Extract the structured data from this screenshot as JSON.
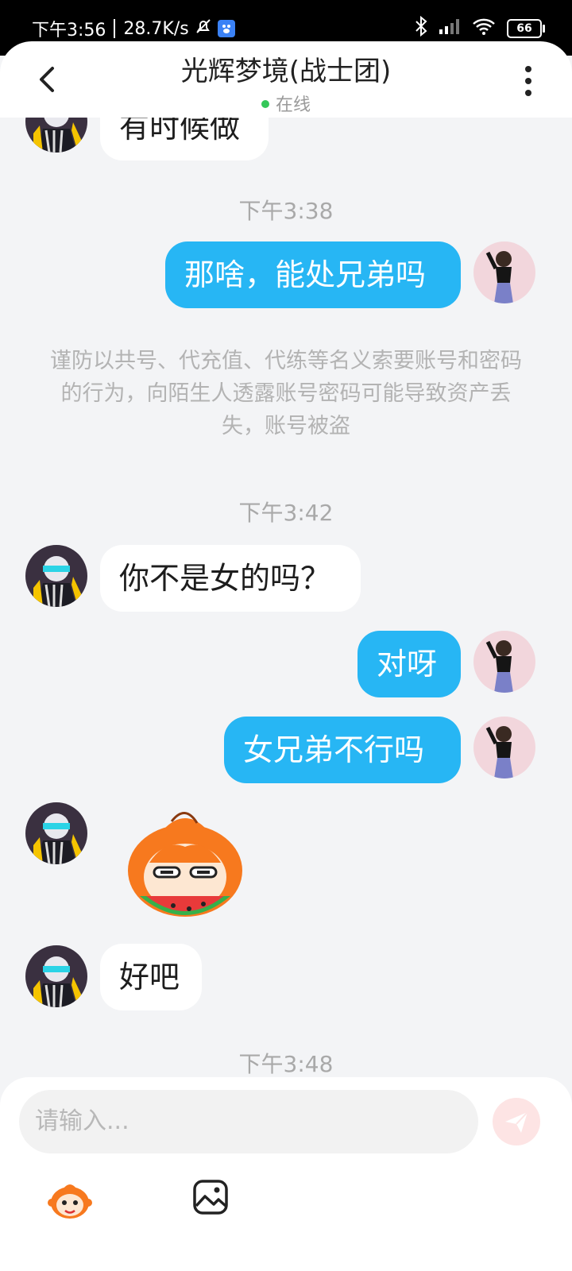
{
  "status_bar": {
    "time": "下午3:56",
    "speed": "28.7K/s",
    "battery": "66"
  },
  "header": {
    "title": "光辉梦境(战士团)",
    "status": "在线"
  },
  "chat": {
    "top_partial_message": "有时候做",
    "timestamps": [
      "下午3:38",
      "下午3:42",
      "下午3:48"
    ],
    "notice": "谨防以共号、代充值、代练等名义索要账号和密码的行为，向陌生人透露账号密码可能导致资产丢失，账号被盗",
    "messages": [
      {
        "side": "out",
        "text": "那啥，能处兄弟吗"
      },
      {
        "side": "in",
        "text": "你不是女的吗？"
      },
      {
        "side": "out",
        "text": "对呀"
      },
      {
        "side": "out",
        "text": "女兄弟不行吗"
      },
      {
        "side": "in",
        "type": "sticker",
        "sticker": "monkey-eating-watermelon"
      },
      {
        "side": "in",
        "text": "好吧"
      }
    ]
  },
  "input": {
    "placeholder": "请输入..."
  },
  "icons": {
    "back": "chevron-left-icon",
    "more": "more-vertical-icon",
    "send": "send-icon",
    "emoji": "monkey-emoji-icon",
    "image": "image-icon"
  },
  "colors": {
    "outgoing_bubble": "#27b6f4",
    "incoming_bubble": "#ffffff",
    "online_dot": "#34c759",
    "background": "#f3f4f6"
  }
}
